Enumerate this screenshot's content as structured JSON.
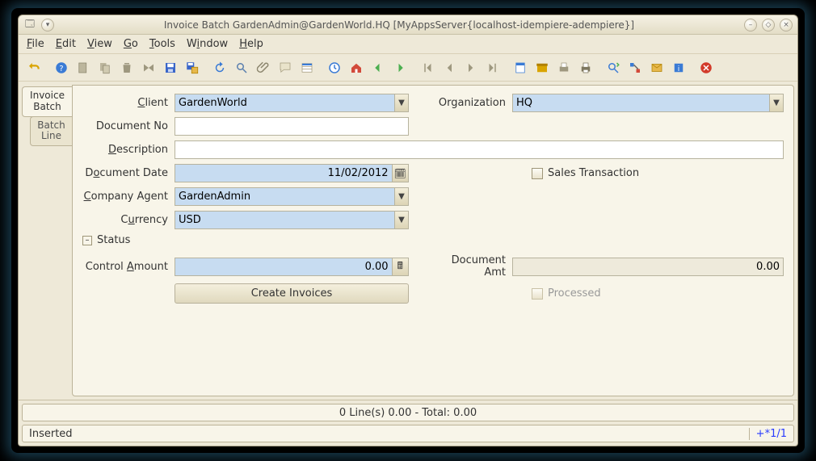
{
  "title": "Invoice Batch  GardenAdmin@GardenWorld.HQ [MyAppsServer{localhost-idempiere-adempiere}]",
  "menu": {
    "file": "File",
    "edit": "Edit",
    "view": "View",
    "go": "Go",
    "tools": "Tools",
    "window": "Window",
    "help": "Help"
  },
  "toolbar_icons": [
    "undo-icon",
    "help-icon",
    "new-icon",
    "copy-icon",
    "delete-icon",
    "delete-selection-icon",
    "save-icon",
    "save-create-icon",
    "refresh-icon",
    "find-icon",
    "attachment-icon",
    "chat-icon",
    "grid-toggle-icon",
    "history-icon",
    "home-icon",
    "back-icon",
    "forward-icon",
    "first-icon",
    "prev-icon",
    "next-icon",
    "last-icon",
    "report-icon",
    "archive-icon",
    "print-preview-icon",
    "print-icon",
    "zoom-across-icon",
    "workflow-icon",
    "request-icon",
    "product-info-icon",
    "close-icon"
  ],
  "tabs": {
    "t1a": "Invoice",
    "t1b": "Batch",
    "t2a": "Batch",
    "t2b": "Line"
  },
  "form": {
    "client_label": "Client",
    "client_value": "GardenWorld",
    "org_label": "Organization",
    "org_value": "HQ",
    "docno_label": "Document No",
    "docno_value": "",
    "desc_label": "Description",
    "desc_value": "",
    "docdate_label": "Document Date",
    "docdate_value": "11/02/2012",
    "salestx_label": "Sales Transaction",
    "agent_label": "Company Agent",
    "agent_value": "GardenAdmin",
    "currency_label": "Currency",
    "currency_value": "USD",
    "status_group": "Status",
    "ctrlamt_label": "Control Amount",
    "ctrlamt_value": "0.00",
    "docamt_label": "Document Amt",
    "docamt_value": "0.00",
    "create_btn": "Create Invoices",
    "processed_label": "Processed"
  },
  "summary": "0 Line(s) 0.00  - Total: 0.00",
  "status_left": "Inserted",
  "status_right": "+*1/1"
}
